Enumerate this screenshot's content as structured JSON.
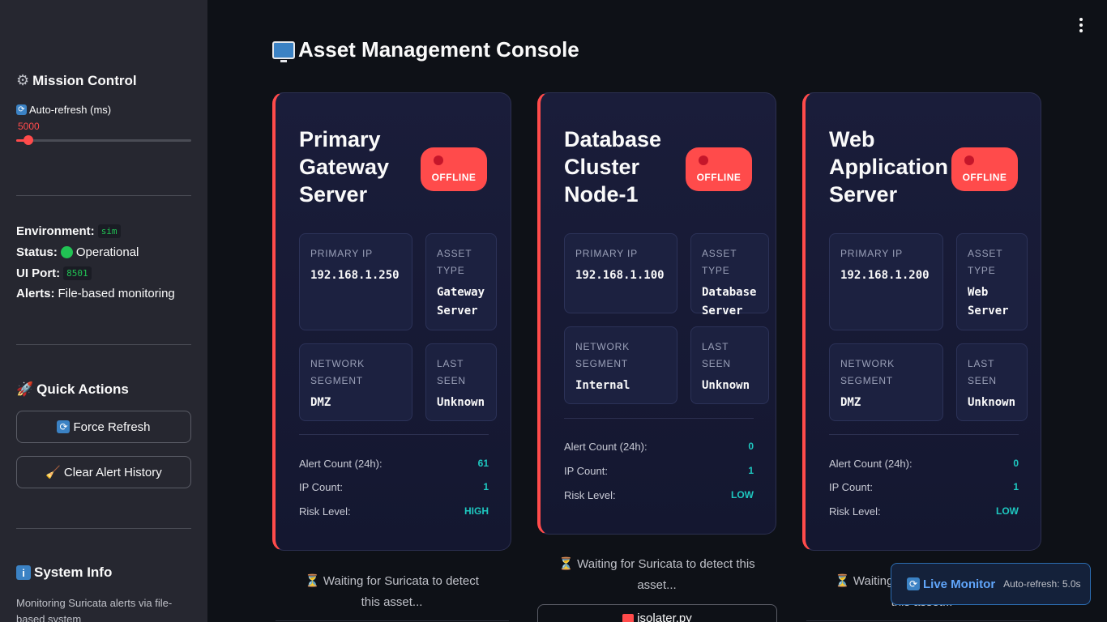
{
  "sidebar": {
    "mission_title": "Mission Control",
    "auto_refresh_label": "Auto-refresh (ms)",
    "auto_refresh_value": "5000",
    "auto_refresh_fraction": 0.07,
    "environment_label": "Environment:",
    "environment_value": "sim",
    "status_label": "Status:",
    "status_value": "Operational",
    "ui_port_label": "UI Port:",
    "ui_port_value": "8501",
    "alerts_label": "Alerts:",
    "alerts_value": "File-based monitoring",
    "quick_actions_title": "Quick Actions",
    "force_refresh_label": "Force Refresh",
    "clear_alert_label": "Clear Alert History",
    "system_info_title": "System Info",
    "system_info_text": "Monitoring Suricata alerts via file-based system"
  },
  "page": {
    "title": "Asset Management Console"
  },
  "labels": {
    "primary_ip": "PRIMARY IP",
    "asset_type": "ASSET TYPE",
    "network_segment": "NETWORK SEGMENT",
    "last_seen": "LAST SEEN",
    "alert_count": "Alert Count (24h):",
    "ip_count": "IP Count:",
    "risk_level": "Risk Level:",
    "offline": "OFFLINE"
  },
  "assets": [
    {
      "name": "Primary Gateway Server",
      "status": "OFFLINE",
      "primary_ip": "192.168.1.250",
      "asset_type": "Gateway Server",
      "network_segment": "DMZ",
      "last_seen": "Unknown",
      "alert_count": "61",
      "ip_count": "1",
      "risk_level": "HIGH",
      "waiting": "⏳ Waiting for Suricata to detect this asset..."
    },
    {
      "name": "Database Cluster Node-1",
      "status": "OFFLINE",
      "primary_ip": "192.168.1.100",
      "asset_type": "Database Server",
      "network_segment": "Internal",
      "last_seen": "Unknown",
      "alert_count": "0",
      "ip_count": "1",
      "risk_level": "LOW",
      "waiting": "⏳ Waiting for Suricata to detect this asset...",
      "script": "isolater.py"
    },
    {
      "name": "Web Application Server",
      "status": "OFFLINE",
      "primary_ip": "192.168.1.200",
      "asset_type": "Web Server",
      "network_segment": "DMZ",
      "last_seen": "Unknown",
      "alert_count": "0",
      "ip_count": "1",
      "risk_level": "LOW",
      "waiting": "⏳ Waiting for Suricata to detect this asset..."
    }
  ],
  "live_monitor": {
    "title": "Live Monitor",
    "subtitle": "Auto-refresh: 5.0s"
  },
  "colors": {
    "accent": "#ff4b4b",
    "stat_value": "#1ec8c0",
    "status_ok": "#21c354",
    "monitor": "#60a5fa"
  }
}
